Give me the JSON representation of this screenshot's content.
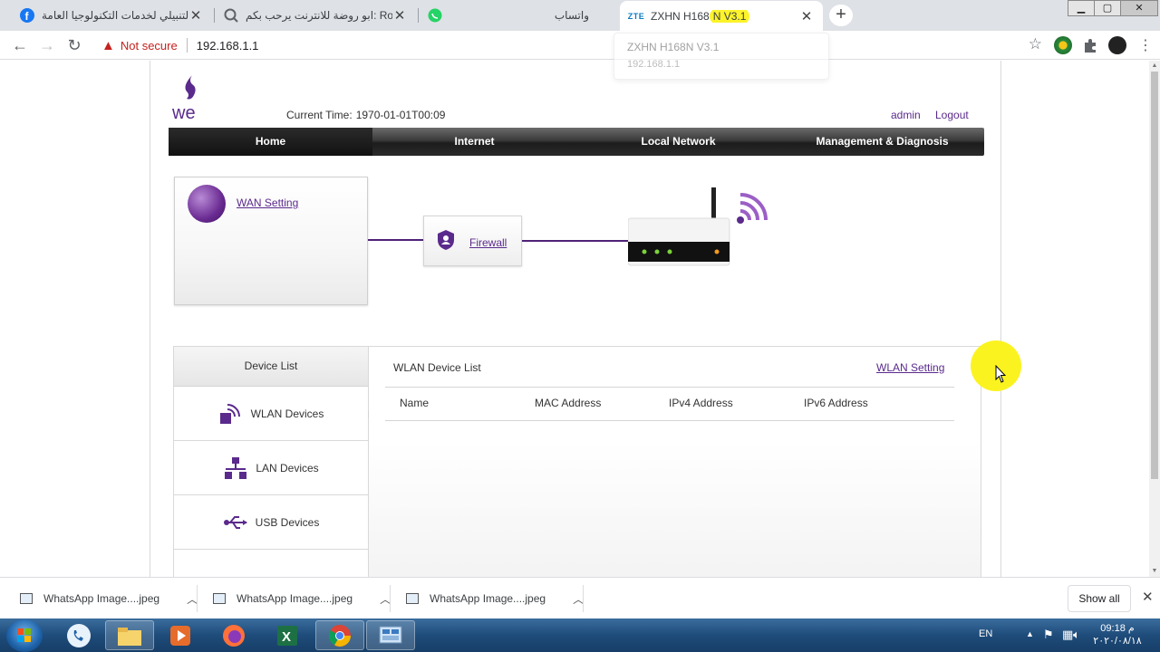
{
  "browser": {
    "tabs": [
      {
        "title": "التنبيلي لخدمات التكنولوجيا العامة | book",
        "icon": "facebook-icon"
      },
      {
        "title": "ابو روضة للانترنت يرحب بكم: Routers",
        "icon": "globe-search-icon"
      },
      {
        "title": "واتساب",
        "icon": "whatsapp-icon"
      },
      {
        "title_prefix": "ZXHN H168",
        "title_highlight": "N V3.1",
        "icon": "zte-icon",
        "icon_text": "ZTE",
        "active": true
      }
    ],
    "window_controls": {
      "minimize": "▁",
      "maximize": "▢",
      "close": "✕"
    },
    "security_label": "Not secure",
    "url": "192.168.1.1",
    "hover_card": {
      "title": "ZXHN H168N V3.1",
      "url": "192.168.1.1"
    }
  },
  "router_page": {
    "current_time_label": "Current Time:",
    "current_time_value": "1970-01-01T00:09",
    "user": "admin",
    "logout": "Logout",
    "menu": [
      "Home",
      "Internet",
      "Local Network",
      "Management & Diagnosis"
    ],
    "active_menu": "Home",
    "topology": {
      "wan_link": "WAN Setting",
      "firewall_link": "Firewall"
    },
    "device_list": {
      "header": "Device List",
      "items": [
        "WLAN Devices",
        "LAN Devices",
        "USB Devices"
      ],
      "panel_title": "WLAN Device List",
      "panel_link": "WLAN Setting",
      "columns": [
        "Name",
        "MAC Address",
        "IPv4 Address",
        "IPv6 Address"
      ]
    }
  },
  "downloads": {
    "items": [
      "WhatsApp Image....jpeg",
      "WhatsApp Image....jpeg",
      "WhatsApp Image....jpeg"
    ],
    "show_all": "Show all"
  },
  "taskbar": {
    "lang": "EN",
    "time": "09:18 م",
    "date": "٢٠٢٠/٠٨/١٨"
  },
  "colors": {
    "brand_purple": "#5a2a8c",
    "highlight_yellow": "#fbf31f"
  }
}
